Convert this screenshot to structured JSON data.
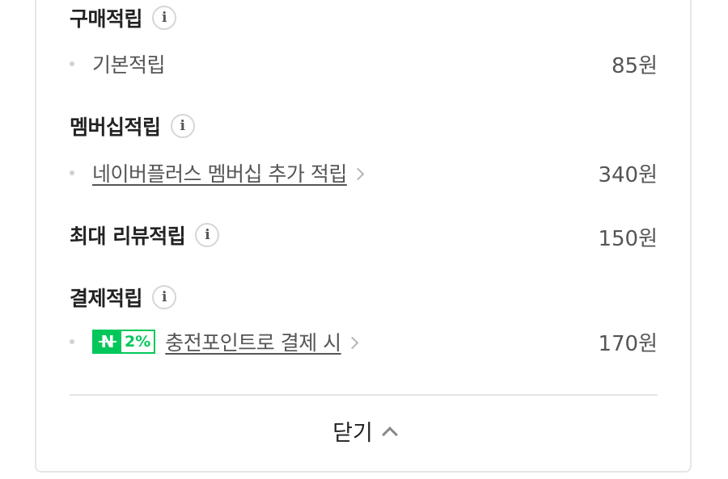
{
  "purchase": {
    "title": "구매적립",
    "info_glyph": "i",
    "items": [
      {
        "label": "기본적립",
        "amount": "85원"
      }
    ]
  },
  "membership": {
    "title": "멤버십적립",
    "info_glyph": "i",
    "items": [
      {
        "label": "네이버플러스 멤버십 추가 적립",
        "amount": "340원"
      }
    ]
  },
  "review": {
    "title": "최대 리뷰적립",
    "info_glyph": "i",
    "amount": "150원"
  },
  "payment": {
    "title": "결제적립",
    "info_glyph": "i",
    "badge": {
      "logo": "N",
      "percent": "2%"
    },
    "items": [
      {
        "label": "충전포인트로 결제 시",
        "amount": "170원"
      }
    ]
  },
  "footer": {
    "close_label": "닫기"
  },
  "colors": {
    "accent_green": "#03c75a",
    "text_dark": "#222222",
    "text_gray": "#555555",
    "border": "#e6e6e6"
  }
}
